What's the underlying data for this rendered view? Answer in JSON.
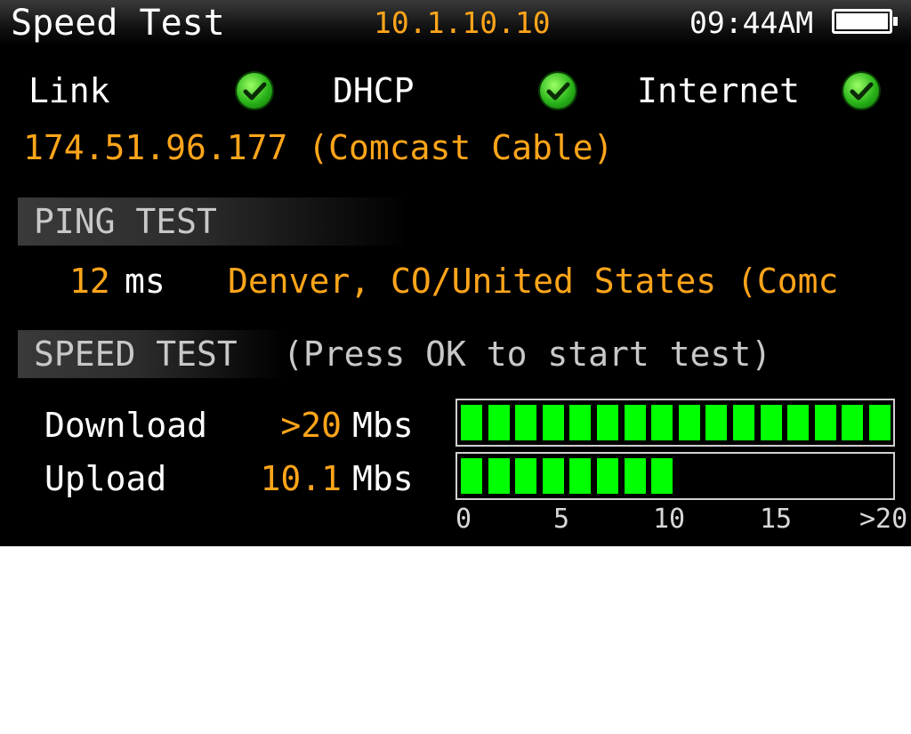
{
  "header": {
    "title": "Speed Test",
    "ip": "10.1.10.10",
    "time": "09:44AM",
    "battery_level": 1.0
  },
  "status": {
    "items": [
      {
        "label": "Link",
        "ok": true
      },
      {
        "label": "DHCP",
        "ok": true
      },
      {
        "label": "Internet",
        "ok": true
      }
    ],
    "public_ip": "174.51.96.177 (Comcast Cable)"
  },
  "ping": {
    "section_title": "PING TEST",
    "value": "12",
    "unit": "ms",
    "server": "Denver, CO/United States (Comc"
  },
  "speed": {
    "section_title": "SPEED TEST",
    "hint": "(Press OK to start test)",
    "download": {
      "label": "Download",
      "value": ">20",
      "unit": "Mbs",
      "level": 20
    },
    "upload": {
      "label": "Upload",
      "value": "10.1",
      "unit": "Mbs",
      "level": 10.1
    },
    "scale": {
      "max": 20,
      "ticks": [
        "0",
        "5",
        "10",
        "15",
        ">20"
      ]
    }
  },
  "colors": {
    "accent": "#ffa51a",
    "bar_fill": "#00ff00",
    "overflow_tick": "#ff1a1a"
  }
}
